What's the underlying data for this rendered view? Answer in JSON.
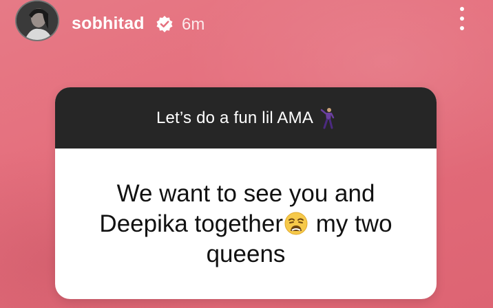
{
  "story": {
    "username": "sobhitad",
    "time_ago": "6m",
    "icons": {
      "avatar": "profile-avatar",
      "verified": "verified-badge-icon",
      "more": "more-options-icon"
    }
  },
  "question_sticker": {
    "prompt": "Let’s do a fun lil AMA",
    "prompt_emoji": "dancing-man-emoji",
    "answer_line_1": "We want to see you and",
    "answer_line_2a": "Deepika together",
    "answer_emoji": "weary-face-emoji",
    "answer_line_2b": " my two",
    "answer_line_3": "queens"
  },
  "colors": {
    "background": "#e5707e",
    "sticker_header": "#262626",
    "sticker_body": "#ffffff"
  }
}
